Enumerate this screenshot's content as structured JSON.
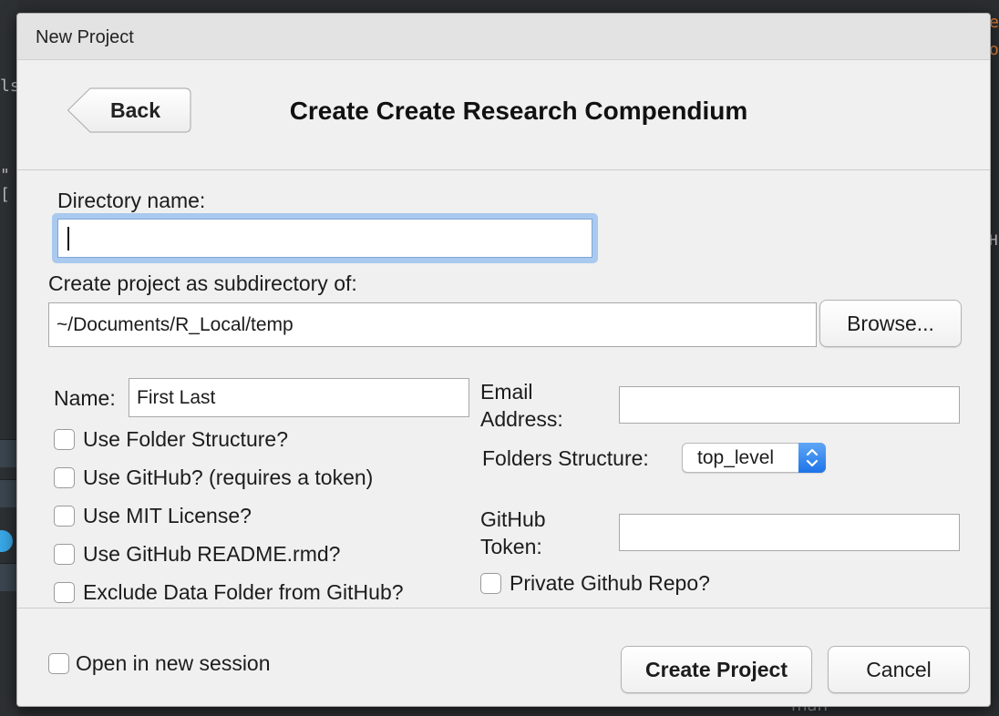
{
  "background": {
    "left_code": [
      "ls",
      "\"["
    ],
    "right_fragments": [
      "e",
      "o",
      "H"
    ],
    "bottom_fragment": "man"
  },
  "dialog": {
    "title": "New Project",
    "back_label": "Back",
    "heading": "Create Create Research Compendium",
    "directory_name": {
      "label": "Directory name:",
      "value": ""
    },
    "subdirectory": {
      "label": "Create project as subdirectory of:",
      "value": "~/Documents/R_Local/temp"
    },
    "browse_label": "Browse...",
    "name": {
      "label": "Name:",
      "value": "First Last"
    },
    "email": {
      "label_line1": "Email",
      "label_line2": "Address:",
      "value": ""
    },
    "folders_structure": {
      "label": "Folders Structure:",
      "selected": "top_level"
    },
    "github_token": {
      "label_line1": "GitHub",
      "label_line2": "Token:",
      "value": ""
    },
    "checkboxes_left": [
      {
        "label": "Use Folder Structure?",
        "checked": false
      },
      {
        "label": "Use GitHub? (requires a token)",
        "checked": false
      },
      {
        "label": "Use MIT License?",
        "checked": false
      },
      {
        "label": "Use GitHub README.rmd?",
        "checked": false
      },
      {
        "label": "Exclude Data Folder from GitHub?",
        "checked": false
      }
    ],
    "private_repo": {
      "label": "Private Github Repo?",
      "checked": false
    },
    "open_new_session": {
      "label": "Open in new session",
      "checked": false
    },
    "create_label": "Create Project",
    "cancel_label": "Cancel"
  },
  "colors": {
    "focus_ring": "#a9c9ee",
    "select_accent": "#1d74e8"
  }
}
